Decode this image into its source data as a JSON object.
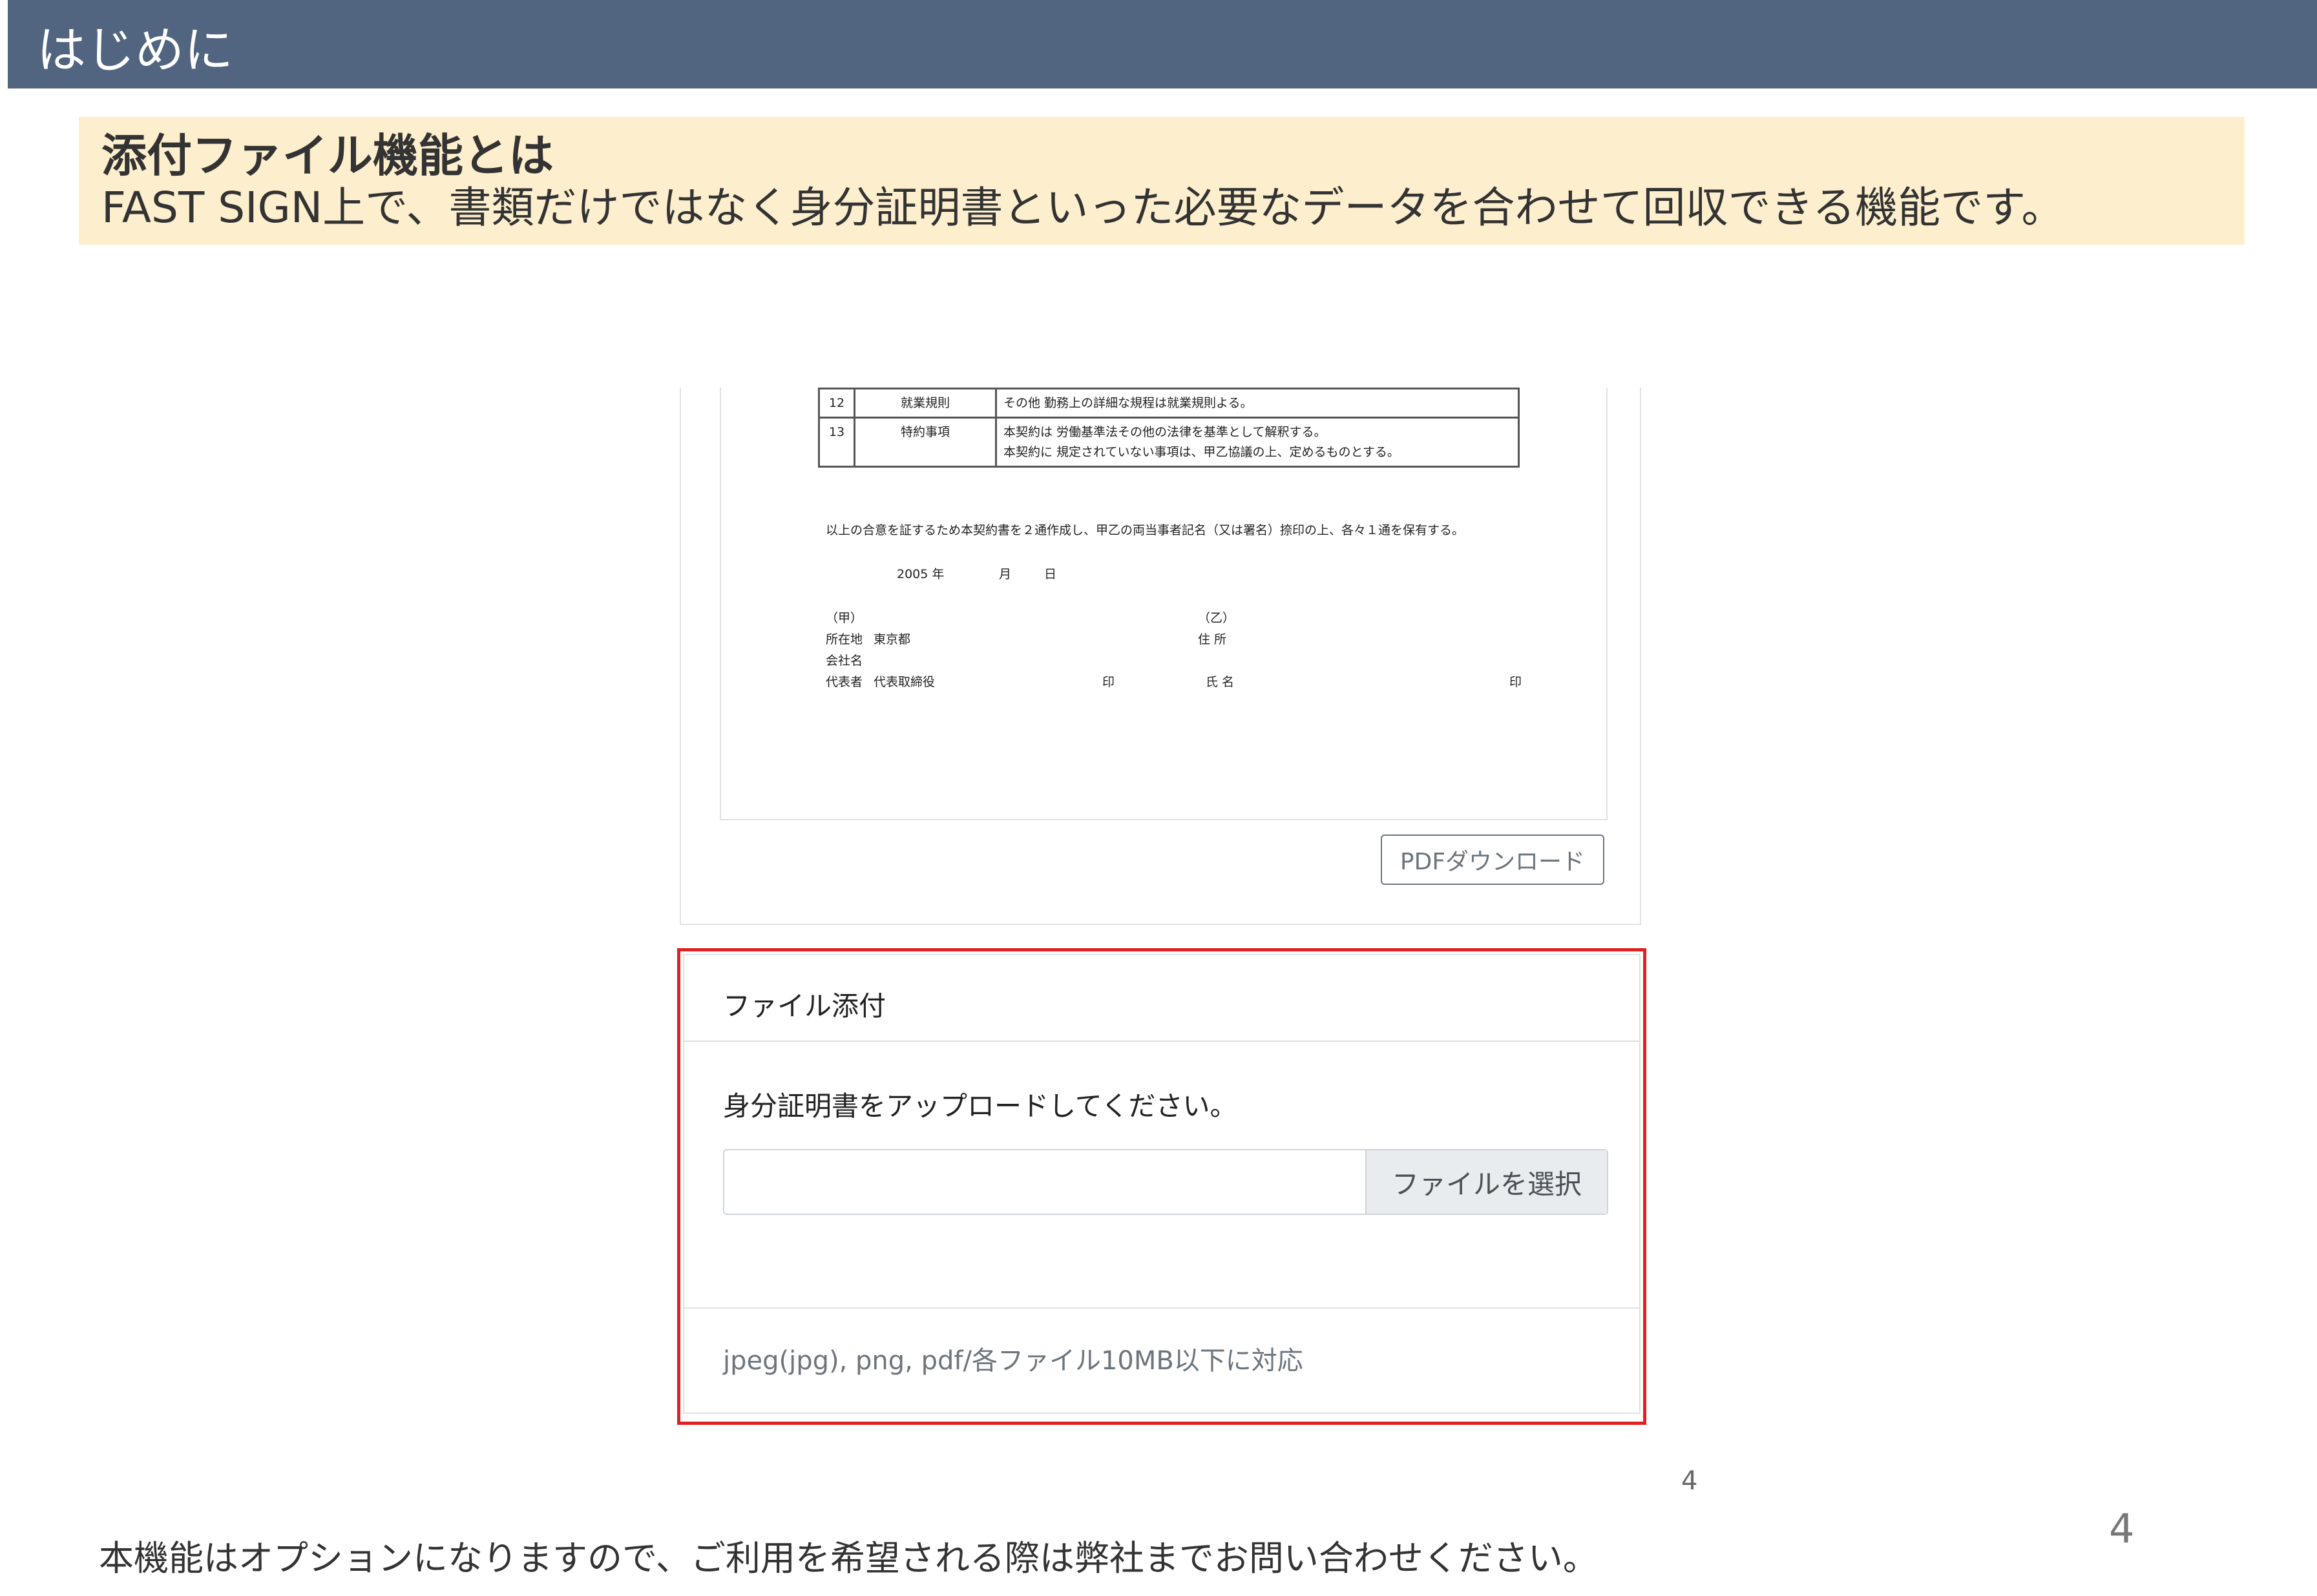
{
  "header": {
    "title": "はじめに"
  },
  "callout": {
    "title": "添付ファイル機能とは",
    "description": "FAST SIGN上で、書類だけではなく身分証明書といった必要なデータを合わせて回収できる機能です。"
  },
  "document": {
    "clauses": [
      {
        "num": "12",
        "label": "就業規則",
        "text": "その他 勤務上の詳細な規程は就業規則よる。"
      },
      {
        "num": "13",
        "label": "特約事項",
        "text": "本契約は 労働基準法その他の法律を基準として解釈する。",
        "text2": "本契約に 規定されていない事項は、甲乙協議の上、定めるものとする。"
      }
    ],
    "agreement": "以上の合意を証するため本契約書を２通作成し、甲乙の両当事者記名（又は署名）捺印の上、各々１通を保有する。",
    "date": {
      "year": "2005 年",
      "month": "月",
      "day": "日"
    },
    "party_a": {
      "label": "（甲）",
      "address_label": "所在地",
      "address": "東京都",
      "company_label": "会社名",
      "rep_label": "代表者",
      "rep_title": "代表取締役",
      "seal": "印"
    },
    "party_b": {
      "label": "（乙）",
      "address_label": "住 所",
      "name_label": "氏 名",
      "seal": "印"
    }
  },
  "pdf_download_label": "PDFダウンロード",
  "attach": {
    "header": "ファイル添付",
    "instruction": "身分証明書をアップロードしてください。",
    "file_value": "",
    "select_label": "ファイルを選択",
    "footer": "jpeg(jpg), png, pdf/各ファイル10MB以下に対応"
  },
  "inner_page_number": "4",
  "page_number": "4",
  "footer_note": "本機能はオプションになりますので、ご利用を希望される際は弊社までお問い合わせください。",
  "colors": {
    "header_bar": "#516480",
    "callout_bg": "#fdefcd",
    "highlight_border": "#e12121"
  }
}
